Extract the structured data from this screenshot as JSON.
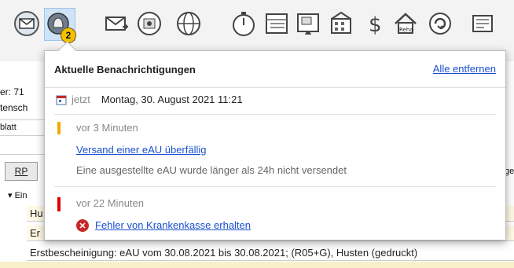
{
  "toolbar": {
    "notification_count": "2",
    "icons": [
      "mail-icon",
      "bell-icon",
      "envelope-icon",
      "phone-book-icon",
      "globe-icon",
      "stopwatch-icon",
      "calendar-icon",
      "monitor-icon",
      "building-icon",
      "dollar-icon",
      "reha-icon",
      "refresh-icon",
      "card-icon"
    ],
    "reha_label": "Reha"
  },
  "background": {
    "label_nr": "er: 71",
    "label_tensch": "tensch",
    "label_blatt": "blatt",
    "rp_button": "RP",
    "list_header": "Ein",
    "row1": "Hu",
    "row2": "Er",
    "row3": "Erstbescheinigung: eAU vom 30.08.2021 bis 30.08.2021; (R05+G), Husten (gedruckt)",
    "right_fragment": "ge"
  },
  "popup": {
    "title": "Aktuelle Benachrichtigungen",
    "clear_all": "Alle entfernen",
    "now_label": "jetzt",
    "now_date": "Montag, 30. August 2021 11:21",
    "notifications": [
      {
        "ago": "vor 3 Minuten",
        "title": "Versand einer eAU überfällig",
        "description": "Eine ausgestellte eAU wurde länger als 24h nicht versendet",
        "color": "#f2a900"
      },
      {
        "ago": "vor 22 Minuten",
        "title": "Fehler von Krankenkasse erhalten",
        "description": "",
        "color": "#e00000"
      }
    ]
  }
}
